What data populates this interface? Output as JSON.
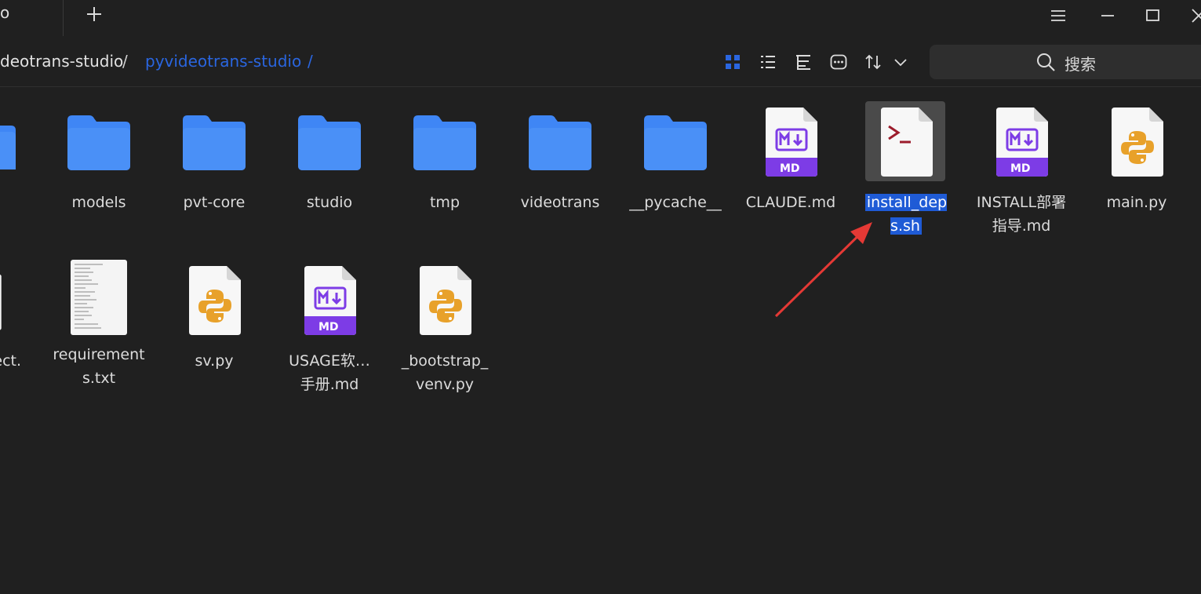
{
  "titlebar": {
    "tab_fragment": "o",
    "new_tab_icon": "plus-icon",
    "window_controls": [
      "menu-icon",
      "minimize-icon",
      "maximize-icon",
      "close-icon"
    ]
  },
  "breadcrumb": {
    "items": [
      "deotrans-studio",
      "pyvideotrans-studio"
    ],
    "separator": "/"
  },
  "view_controls": [
    "grid-view-icon",
    "list-view-icon",
    "tree-view-icon",
    "more-icon",
    "sort-icon",
    "chevron-down-icon"
  ],
  "search": {
    "placeholder": "搜索"
  },
  "files": [
    {
      "label": "models",
      "type": "folder"
    },
    {
      "label": "pvt-core",
      "type": "folder"
    },
    {
      "label": "studio",
      "type": "folder"
    },
    {
      "label": "tmp",
      "type": "folder"
    },
    {
      "label": "videotrans",
      "type": "folder"
    },
    {
      "label": "__pycache__",
      "type": "folder"
    },
    {
      "label": "CLAUDE.md",
      "type": "markdown",
      "badge": "MD"
    },
    {
      "label": "install_deps.sh",
      "type": "shell",
      "selected": true
    },
    {
      "label": "INSTALL部署指导.md",
      "type": "markdown",
      "badge": "MD"
    },
    {
      "label": "main.py",
      "type": "python"
    },
    {
      "label": "ect.",
      "type": "text-partial"
    },
    {
      "label": "requirements.txt",
      "type": "text"
    },
    {
      "label": "sv.py",
      "type": "python"
    },
    {
      "label": "USAGE软…手册.md",
      "type": "markdown",
      "badge": "MD"
    },
    {
      "label": "_bootstrap_venv.py",
      "type": "python"
    }
  ],
  "colors": {
    "background": "#202020",
    "folder": "#3f86f5",
    "markdown_badge": "#7d3ce6",
    "selection": "#1f5bd6",
    "link_blue": "#2a66e0",
    "arrow": "#e53935"
  }
}
